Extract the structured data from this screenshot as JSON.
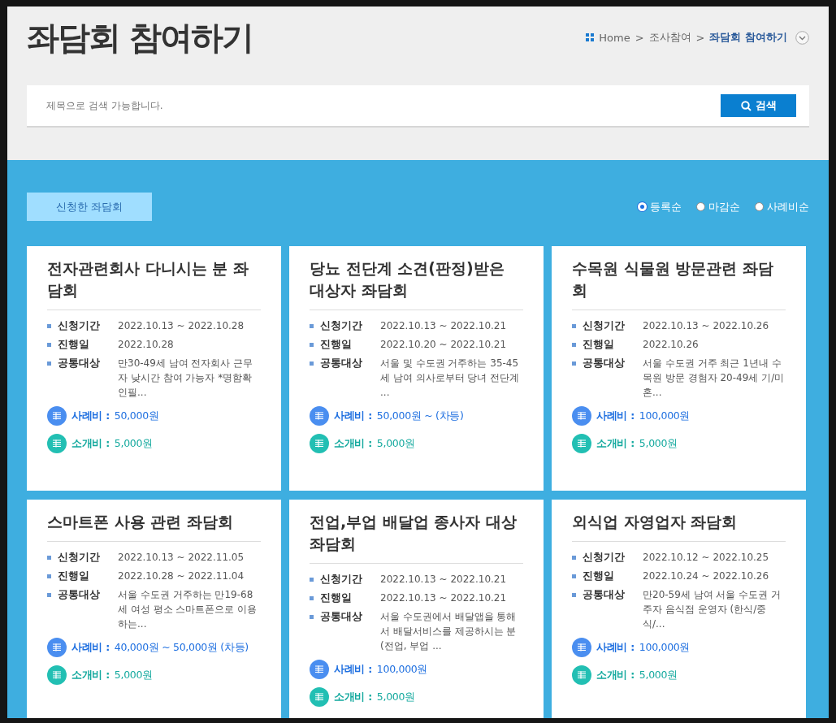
{
  "page_title": "좌담회 참여하기",
  "breadcrumb": [
    {
      "label": "Home",
      "current": false
    },
    {
      "label": "조사참여",
      "current": false
    },
    {
      "label": "좌담회 참여하기",
      "current": true
    }
  ],
  "breadcrumb_separator": ">",
  "search": {
    "placeholder": "제목으로 검색 가능합니다.",
    "button": "검색"
  },
  "applied_button": "신청한 좌담회",
  "sort_options": [
    {
      "label": "등록순",
      "selected": true
    },
    {
      "label": "마감순",
      "selected": false
    },
    {
      "label": "사례비순",
      "selected": false
    }
  ],
  "cards": [
    {
      "title": "전자관련회사 다니시는 분 좌담회",
      "info": [
        {
          "label": "신청기간",
          "value": "2022.10.13 ~ 2022.10.28"
        },
        {
          "label": "진행일",
          "value": "2022.10.28"
        },
        {
          "label": "공통대상",
          "value": "만30-49세 남여 전자회사 근무자 낮시간 참여 가능자 *명함확인필..."
        }
      ],
      "fees": [
        {
          "kind": "reward",
          "label": "사례비 :",
          "value": "50,000원"
        },
        {
          "kind": "referral",
          "label": "소개비 :",
          "value": "5,000원"
        }
      ]
    },
    {
      "title": "당뇨 전단계 소견(판정)받은 대상자 좌담회",
      "info": [
        {
          "label": "신청기간",
          "value": "2022.10.13 ~ 2022.10.21"
        },
        {
          "label": "진행일",
          "value": "2022.10.20 ~ 2022.10.21"
        },
        {
          "label": "공통대상",
          "value": "서울 및 수도권 거주하는 35-45세 남여 의사로부터 당녀 전단계 ..."
        }
      ],
      "fees": [
        {
          "kind": "reward",
          "label": "사례비 :",
          "value": "50,000원 ~ (차등)"
        },
        {
          "kind": "referral",
          "label": "소개비 :",
          "value": "5,000원"
        }
      ]
    },
    {
      "title": "수목원 식물원 방문관련 좌담회",
      "info": [
        {
          "label": "신청기간",
          "value": "2022.10.13 ~ 2022.10.26"
        },
        {
          "label": "진행일",
          "value": "2022.10.26"
        },
        {
          "label": "공통대상",
          "value": "서울 수도권 거주 최근 1년내 수목원 방문 경험자 20-49세 기/미혼..."
        }
      ],
      "fees": [
        {
          "kind": "reward",
          "label": "사례비 :",
          "value": "100,000원"
        },
        {
          "kind": "referral",
          "label": "소개비 :",
          "value": "5,000원"
        }
      ]
    },
    {
      "title": "스마트폰 사용 관련 좌담회",
      "info": [
        {
          "label": "신청기간",
          "value": "2022.10.13 ~ 2022.11.05"
        },
        {
          "label": "진행일",
          "value": "2022.10.28 ~ 2022.11.04"
        },
        {
          "label": "공통대상",
          "value": "서울 수도권 거주하는 만19-68세 여성 평소 스마트폰으로 이용하는..."
        }
      ],
      "fees": [
        {
          "kind": "reward",
          "label": "사례비 :",
          "value": "40,000원 ~ 50,000원 (차등)"
        },
        {
          "kind": "referral",
          "label": "소개비 :",
          "value": "5,000원"
        }
      ]
    },
    {
      "title": "전업,부업 배달업 종사자 대상 좌담회",
      "info": [
        {
          "label": "신청기간",
          "value": "2022.10.13 ~ 2022.10.21"
        },
        {
          "label": "진행일",
          "value": "2022.10.13 ~ 2022.10.21"
        },
        {
          "label": "공통대상",
          "value": "서울 수도권에서 배달앱을 통해서 배달서비스를 제공하시는 분(전업, 부업 ..."
        }
      ],
      "fees": [
        {
          "kind": "reward",
          "label": "사례비 :",
          "value": "100,000원"
        },
        {
          "kind": "referral",
          "label": "소개비 :",
          "value": "5,000원"
        }
      ]
    },
    {
      "title": "외식업 자영업자 좌담회",
      "info": [
        {
          "label": "신청기간",
          "value": "2022.10.12 ~ 2022.10.25"
        },
        {
          "label": "진행일",
          "value": "2022.10.24 ~ 2022.10.26"
        },
        {
          "label": "공통대상",
          "value": "만20-59세 남여 서울 수도권 거주자 음식점 운영자 (한식/중식/..."
        }
      ],
      "fees": [
        {
          "kind": "reward",
          "label": "사례비 :",
          "value": "100,000원"
        },
        {
          "kind": "referral",
          "label": "소개비 :",
          "value": "5,000원"
        }
      ]
    }
  ]
}
